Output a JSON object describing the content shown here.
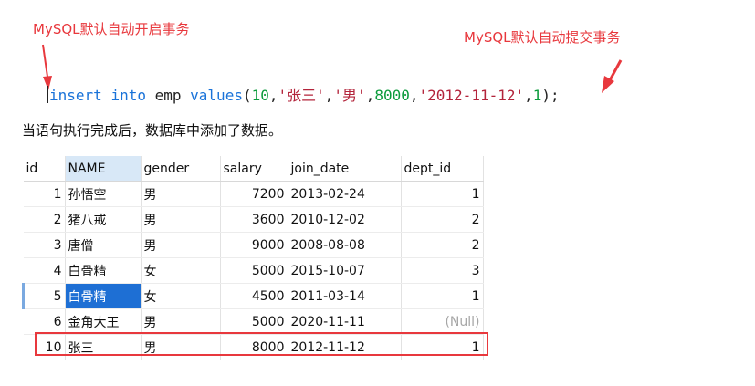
{
  "annotations": {
    "left": "MySQL默认自动开启事务",
    "right": "MySQL默认自动提交事务"
  },
  "sql": {
    "kw_insert": "insert",
    "kw_into": "into",
    "table": "emp",
    "kw_values": "values",
    "open": "(",
    "v_id": "10",
    "v_name": "'张三'",
    "v_gender": "'男'",
    "v_salary": "8000",
    "v_date": "'2012-11-12'",
    "v_dept": "1",
    "close": ");"
  },
  "caption": "当语句执行完成后，数据库中添加了数据。",
  "table": {
    "columns": [
      "id",
      "NAME",
      "gender",
      "salary",
      "join_date",
      "dept_id"
    ],
    "rows": [
      {
        "id": "1",
        "name": "孙悟空",
        "gender": "男",
        "salary": "7200",
        "join_date": "2013-02-24",
        "dept_id": "1"
      },
      {
        "id": "2",
        "name": "猪八戒",
        "gender": "男",
        "salary": "3600",
        "join_date": "2010-12-02",
        "dept_id": "2"
      },
      {
        "id": "3",
        "name": "唐僧",
        "gender": "男",
        "salary": "9000",
        "join_date": "2008-08-08",
        "dept_id": "2"
      },
      {
        "id": "4",
        "name": "白骨精",
        "gender": "女",
        "salary": "5000",
        "join_date": "2015-10-07",
        "dept_id": "3"
      },
      {
        "id": "5",
        "name": "白骨精",
        "gender": "女",
        "salary": "4500",
        "join_date": "2011-03-14",
        "dept_id": "1"
      },
      {
        "id": "6",
        "name": "金角大王",
        "gender": "男",
        "salary": "5000",
        "join_date": "2020-11-11",
        "dept_id": "(Null)"
      },
      {
        "id": "10",
        "name": "张三",
        "gender": "男",
        "salary": "8000",
        "join_date": "2012-11-12",
        "dept_id": "1"
      }
    ]
  },
  "colors": {
    "annotation": "#e8383d",
    "keyword": "#1a73d9",
    "number": "#0b9b3b",
    "string": "#b3243b",
    "selection": "#1e6fd4",
    "null_text": "#a6a6a6"
  }
}
